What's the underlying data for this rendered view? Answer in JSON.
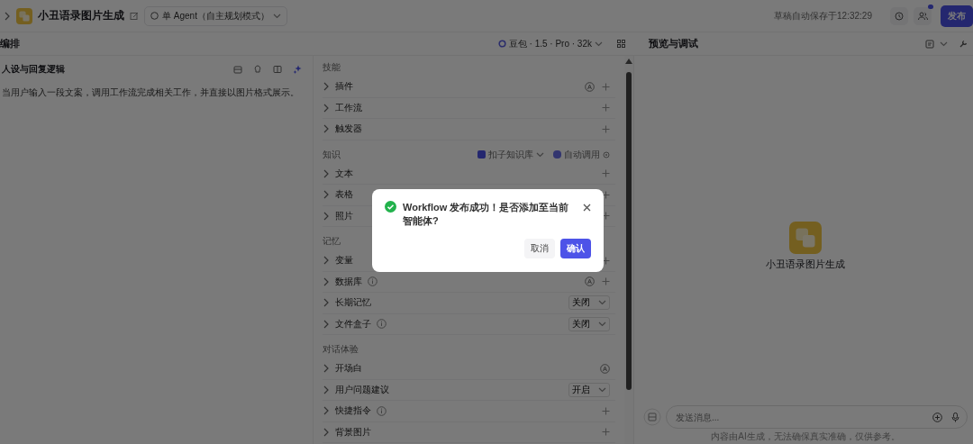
{
  "topbar": {
    "title": "小丑语录图片生成",
    "mode": "单 Agent（自主规划模式）",
    "autosave": "草稿自动保存于12:32:29",
    "publish": "发布"
  },
  "header": {
    "left_title": "编排",
    "model": "豆包 · 1.5 · Pro · 32k",
    "right_title": "预览与调试"
  },
  "persona": {
    "title": "人设与回复逻辑",
    "text": "当用户输入一段文案，调用工作流完成相关工作，并直接以图片格式展示。"
  },
  "sections": [
    {
      "title": "技能",
      "items": [
        {
          "label": "插件",
          "info": false,
          "auto": true,
          "plus": true
        },
        {
          "label": "工作流",
          "info": false,
          "auto": false,
          "plus": true
        },
        {
          "label": "触发器",
          "info": false,
          "auto": false,
          "plus": true
        }
      ]
    },
    {
      "title": "知识",
      "source": "扣子知识库",
      "mode": "自动调用",
      "items": [
        {
          "label": "文本",
          "info": false,
          "auto": false,
          "plus": true
        },
        {
          "label": "表格",
          "info": false,
          "auto": false,
          "plus": true
        },
        {
          "label": "照片",
          "info": false,
          "auto": false,
          "plus": true
        }
      ]
    },
    {
      "title": "记忆",
      "items": [
        {
          "label": "变量",
          "info": false,
          "auto": false,
          "plus": true
        },
        {
          "label": "数据库",
          "info": true,
          "auto": true,
          "plus": true
        },
        {
          "label": "长期记忆",
          "info": false,
          "auto": false,
          "plus": false,
          "select": "关闭"
        },
        {
          "label": "文件盒子",
          "info": true,
          "auto": false,
          "plus": false,
          "select": "关闭"
        }
      ]
    },
    {
      "title": "对话体验",
      "items": [
        {
          "label": "开场白",
          "info": false,
          "auto": true,
          "plus": false
        },
        {
          "label": "用户问题建议",
          "info": false,
          "auto": false,
          "plus": false,
          "select": "开启"
        },
        {
          "label": "快捷指令",
          "info": true,
          "auto": false,
          "plus": true
        },
        {
          "label": "背景图片",
          "info": false,
          "auto": false,
          "plus": true
        }
      ]
    }
  ],
  "preview": {
    "name": "小丑语录图片生成",
    "placeholder": "发送消息...",
    "disclaimer": "内容由AI生成，无法确保真实准确，仅供参考。"
  },
  "dialog": {
    "message": "Workflow 发布成功！是否添加至当前智能体?",
    "cancel": "取消",
    "confirm": "确认"
  }
}
